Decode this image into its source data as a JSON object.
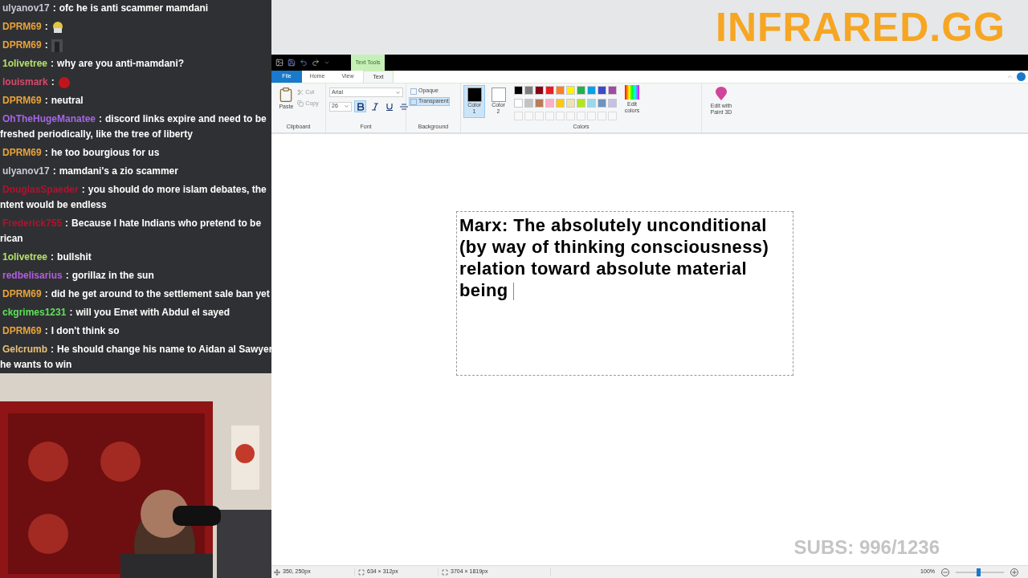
{
  "overlay": {
    "logo": "INFRARED.GG",
    "subs": "SUBS: 996/1236"
  },
  "chat": [
    {
      "user": "ulyanov17",
      "color": "#c9c9d6",
      "sep": ":",
      "kind": "text",
      "text": "ofc he is anti scammer mamdani"
    },
    {
      "user": "DPRM69",
      "color": "#e8a33a",
      "sep": ":",
      "kind": "emote"
    },
    {
      "user": "DPRM69",
      "color": "#e8a33a",
      "sep": ":",
      "kind": "emote"
    },
    {
      "user": "1olivetree",
      "color": "#b5e06a",
      "sep": ":",
      "kind": "text",
      "text": "why are you anti-mamdani?"
    },
    {
      "user": "louismark",
      "color": "#d8486a",
      "sep": ":",
      "kind": "emote"
    },
    {
      "user": "DPRM69",
      "color": "#e8a33a",
      "sep": ":",
      "kind": "text",
      "text": "neutral"
    },
    {
      "user": "OhTheHugeManatee",
      "color": "#a565e8",
      "sep": ":",
      "kind": "text",
      "text": "discord links expire and need to be",
      "more": "freshed periodically, like the tree of liberty"
    },
    {
      "user": "DPRM69",
      "color": "#e8a33a",
      "sep": ":",
      "kind": "text",
      "text": "he too bourgious for us"
    },
    {
      "user": "ulyanov17",
      "color": "#c9c9d6",
      "sep": ":",
      "kind": "text",
      "text": "mamdani's a zio scammer"
    },
    {
      "user": "DouglasSpaeder",
      "color": "#b3122e",
      "sep": ":",
      "kind": "text",
      "text": "you should do more islam debates, the",
      "more": "ntent would be endless"
    },
    {
      "user": "Frederick755",
      "color": "#b3122e",
      "sep": ":",
      "kind": "text",
      "text": "Because I hate Indians who pretend to be",
      "more": "rican"
    },
    {
      "user": "1olivetree",
      "color": "#b5e06a",
      "sep": ":",
      "kind": "text",
      "text": "bullshit"
    },
    {
      "user": "redbelisarius",
      "color": "#b25ee0",
      "sep": ":",
      "kind": "text",
      "text": "gorillaz in the sun"
    },
    {
      "user": "DPRM69",
      "color": "#e8a33a",
      "sep": ":",
      "kind": "text",
      "text": "did he get around to the settlement sale ban yet"
    },
    {
      "user": "ckgrimes1231",
      "color": "#5fe05a",
      "sep": ":",
      "kind": "text",
      "text": "will you Emet with Abdul el sayed"
    },
    {
      "user": "DPRM69",
      "color": "#e8a33a",
      "sep": ":",
      "kind": "text",
      "text": "I don't think so"
    },
    {
      "user": "Gelcrumb",
      "color": "#e8c07a",
      "sep": ":",
      "kind": "text",
      "text": "He should change his name to Aidan al Sawyer",
      "more": "he wants to win"
    }
  ],
  "paint": {
    "contextual_tab": "Text Tools",
    "tabs": [
      {
        "label": "File",
        "selected": false
      },
      {
        "label": "Home",
        "selected": false
      },
      {
        "label": "View",
        "selected": false
      },
      {
        "label": "Text",
        "selected": true
      }
    ],
    "clipboard": {
      "paste": "Paste",
      "cut": "Cut",
      "copy": "Copy",
      "label": "Clipboard"
    },
    "font": {
      "family": "Arial",
      "size": "26",
      "label": "Font",
      "styles": [
        {
          "kind": "bold",
          "selected": true
        },
        {
          "kind": "italic",
          "selected": false
        },
        {
          "kind": "underline",
          "selected": false
        },
        {
          "kind": "strike",
          "selected": false
        }
      ]
    },
    "background": {
      "label": "Background",
      "options": [
        {
          "label": "Opaque",
          "selected": false
        },
        {
          "label": "Transparent",
          "selected": true
        }
      ]
    },
    "colors": {
      "label": "Colors",
      "color1": {
        "label": "Color",
        "num": "1",
        "color": "#000000",
        "selected": true
      },
      "color2": {
        "label": "Color",
        "num": "2",
        "color": "#ffffff",
        "selected": false
      },
      "palette": [
        {
          "color": "#000000"
        },
        {
          "color": "#7f7f7f"
        },
        {
          "color": "#880015"
        },
        {
          "color": "#ed1c24"
        },
        {
          "color": "#ff7f27"
        },
        {
          "color": "#fff200"
        },
        {
          "color": "#22b14c"
        },
        {
          "color": "#00a2e8"
        },
        {
          "color": "#3f48cc"
        },
        {
          "color": "#a349a4"
        },
        {
          "color": "#ffffff"
        },
        {
          "color": "#c3c3c3"
        },
        {
          "color": "#b97a57"
        },
        {
          "color": "#ffaec9"
        },
        {
          "color": "#ffc90e"
        },
        {
          "color": "#efe4b0"
        },
        {
          "color": "#b5e61d"
        },
        {
          "color": "#99d9ea"
        },
        {
          "color": "#7092be"
        },
        {
          "color": "#c8bfe7"
        }
      ],
      "edit": "Edit colors"
    },
    "paint3d": "Edit with Paint 3D",
    "canvas_text": "Marx: The absolutely unconditional (by way of thinking consciousness) relation toward absolute material being",
    "status": {
      "position": "350, 250px",
      "selection": "634 × 312px",
      "size": "3704 × 1819px",
      "zoom": "100%",
      "zoom_slider": {
        "level": 0.47
      }
    }
  }
}
